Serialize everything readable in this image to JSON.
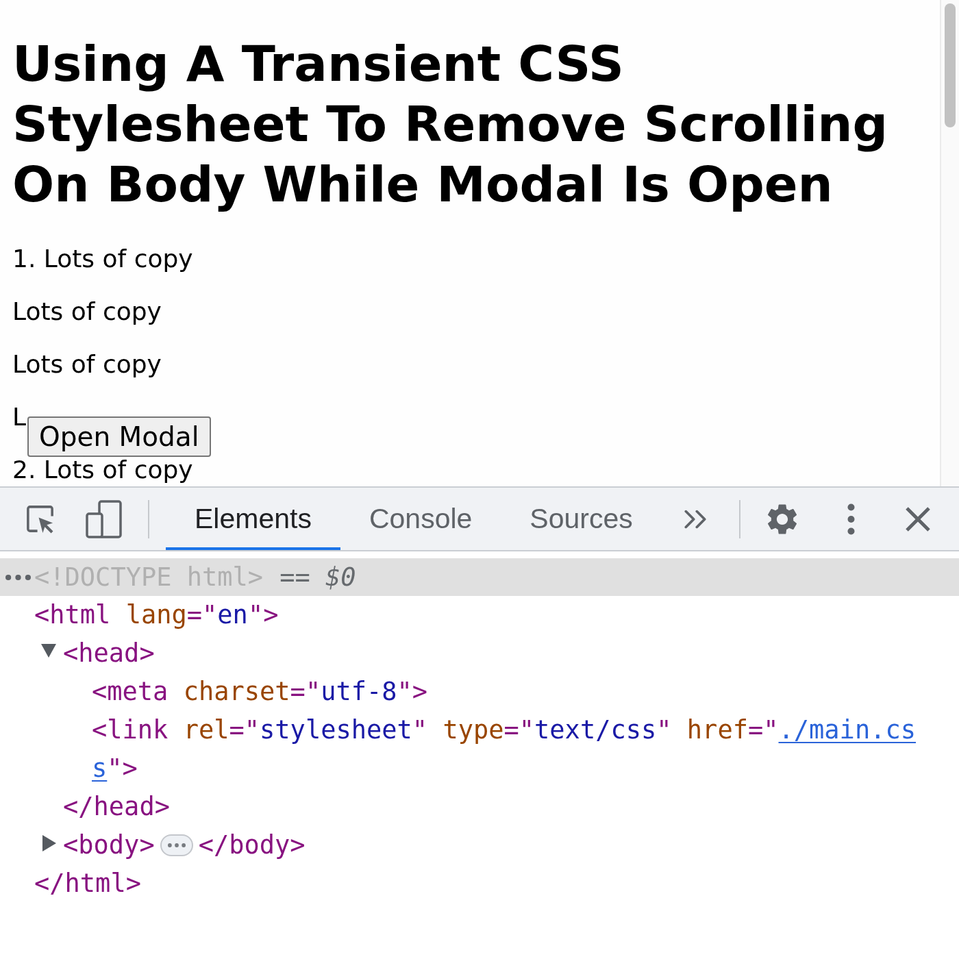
{
  "page": {
    "heading": "Using A Transient CSS Stylesheet To Remove Scrolling On Body While Modal Is Open",
    "paragraphs": [
      "1. Lots of copy",
      "Lots of copy",
      "Lots of copy",
      "L",
      "2. Lots of copy"
    ],
    "open_modal_button": "Open Modal"
  },
  "devtools": {
    "tabs": [
      {
        "label": "Elements",
        "selected": true
      },
      {
        "label": "Console",
        "selected": false
      },
      {
        "label": "Sources",
        "selected": false
      }
    ],
    "dom_tree": [
      {
        "selected": true,
        "tokens": [
          {
            "kind": "muted",
            "text": "<!DOCTYPE html>"
          }
        ],
        "suffix": "== *$0*"
      },
      {
        "selected": false,
        "tokens": [
          {
            "kind": "tag",
            "text": "<html"
          },
          {
            "kind": "attr",
            "text": " lang"
          },
          {
            "kind": "tag",
            "text": "=\""
          },
          {
            "kind": "value",
            "text": "en"
          },
          {
            "kind": "tag",
            "text": "\">"
          }
        ],
        "children": [
          {
            "selected": false,
            "expanded": true,
            "tokens": [
              {
                "kind": "tag",
                "text": "<head>"
              }
            ],
            "children": [
              {
                "selected": false,
                "tokens": [
                  {
                    "kind": "tag",
                    "text": "<meta"
                  },
                  {
                    "kind": "attr",
                    "text": " charset"
                  },
                  {
                    "kind": "tag",
                    "text": "=\""
                  },
                  {
                    "kind": "value",
                    "text": "utf-8"
                  },
                  {
                    "kind": "tag",
                    "text": "\">"
                  }
                ]
              },
              {
                "selected": false,
                "lines": [
                  [
                    {
                      "kind": "tag",
                      "text": "<link"
                    },
                    {
                      "kind": "attr",
                      "text": " rel"
                    },
                    {
                      "kind": "tag",
                      "text": "=\""
                    },
                    {
                      "kind": "value",
                      "text": "stylesheet"
                    },
                    {
                      "kind": "tag",
                      "text": "\""
                    },
                    {
                      "kind": "attr",
                      "text": " type"
                    },
                    {
                      "kind": "tag",
                      "text": "=\""
                    },
                    {
                      "kind": "value",
                      "text": "text/css"
                    },
                    {
                      "kind": "tag",
                      "text": "\""
                    },
                    {
                      "kind": "attr",
                      "text": " href"
                    },
                    {
                      "kind": "tag",
                      "text": "=\""
                    },
                    {
                      "kind": "link",
                      "text": "./main.cs"
                    }
                  ],
                  [
                    {
                      "kind": "link",
                      "text": "s"
                    },
                    {
                      "kind": "tag",
                      "text": "\">"
                    }
                  ]
                ]
              }
            ],
            "closing": [
              {
                "kind": "tag",
                "text": "</head>"
              }
            ]
          },
          {
            "selected": false,
            "expanded": false,
            "tokens": [
              {
                "kind": "tag",
                "text": "<body>"
              }
            ],
            "closing": [
              {
                "kind": "tag",
                "text": "</body>"
              }
            ]
          }
        ],
        "closing": [
          {
            "kind": "tag",
            "text": "</html>"
          }
        ]
      }
    ]
  }
}
